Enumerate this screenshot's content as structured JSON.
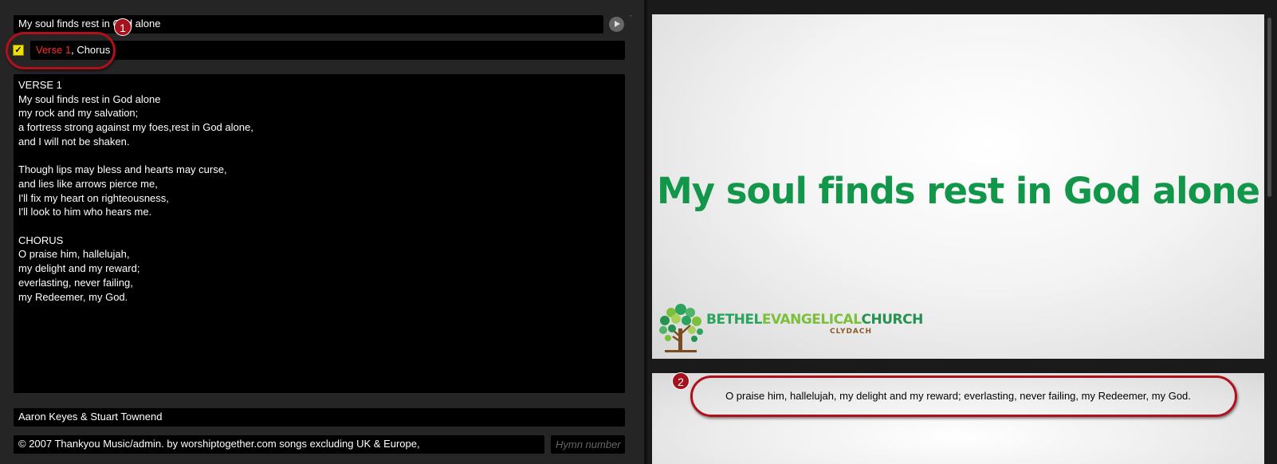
{
  "editor": {
    "title": "My soul finds rest in God alone",
    "verse_order": {
      "active": "Verse 1",
      "rest": ", Chorus"
    },
    "checkbox_mark": "✓",
    "lyrics": "VERSE 1\nMy soul finds rest in God alone\nmy rock and my salvation;\na fortress strong against my foes,rest in God alone,\nand I will not be shaken.\n\nThough lips may bless and hearts may curse,\nand lies like arrows pierce me,\nI'll fix my heart on righteousness,\nI'll look to him who hears me.\n\nCHORUS\nO praise him, hallelujah,\nmy delight and my reward;\neverlasting, never failing,\nmy Redeemer, my God.",
    "author": "Aaron Keyes & Stuart Townend",
    "copyright": "© 2007 Thankyou Music/admin. by worshiptogether.com songs excluding UK & Europe,",
    "hymn_number_placeholder": "Hymn number",
    "scroll_caret": "ˆ"
  },
  "callouts": {
    "one": "1",
    "two": "2"
  },
  "preview": {
    "slide_title": "My soul finds rest in God alone",
    "church_name": {
      "part1": "BETHEL",
      "part2": "EVANGELICAL",
      "part3": "CHURCH"
    },
    "church_location": "CLYDACH",
    "next_slide_text": "O praise him, hallelujah, my delight and my reward; everlasting, never failing, my Redeemer, my God."
  },
  "colors": {
    "accent_red": "#ff2a2a",
    "title_green": "#12964a",
    "callout_red": "#b0101a",
    "checkbox_yellow": "#f0e000"
  },
  "icons": {
    "play": "play-icon",
    "logo": "tree-logo-icon"
  }
}
